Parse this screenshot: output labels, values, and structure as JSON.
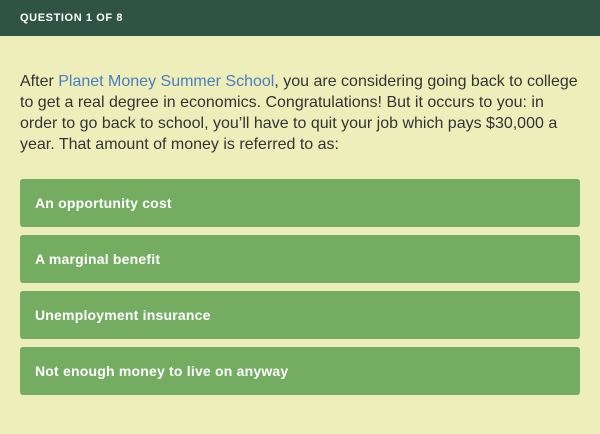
{
  "header": {
    "label": "QUESTION 1 OF 8"
  },
  "question": {
    "text_before_link": "After ",
    "link_text": "Planet Money Summer School",
    "text_after_link": ", you are considering going back to college to get a real degree in economics. Congratulations! But it occurs to you: in order to go back to school, you’ll have to quit your job which pays $30,000 a year. That amount of money is referred to as:"
  },
  "answers": [
    {
      "label": "An opportunity cost"
    },
    {
      "label": "A marginal benefit"
    },
    {
      "label": "Unemployment insurance"
    },
    {
      "label": "Not enough money to live on anyway"
    }
  ],
  "colors": {
    "header_bg": "#2f5446",
    "page_bg": "#eeeebb",
    "answer_bg": "#74ad62",
    "link": "#4a7ec0",
    "text": "#333333"
  }
}
